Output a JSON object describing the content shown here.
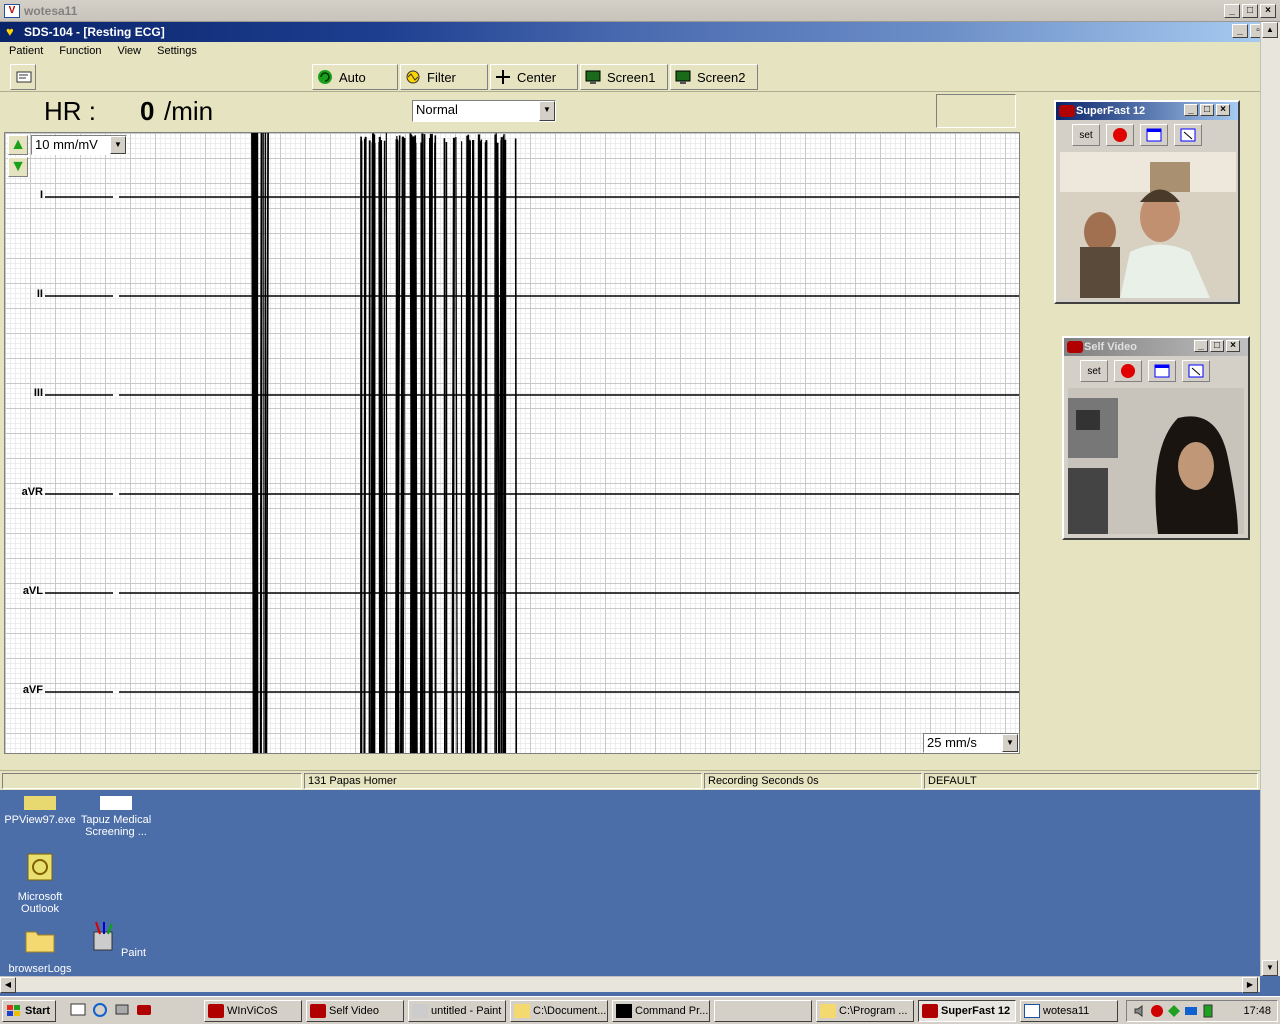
{
  "outer_window": {
    "title": "wotesa11",
    "icon_text": "V"
  },
  "app_window": {
    "title": "SDS-104 - [Resting ECG]"
  },
  "menu": [
    "Patient",
    "Function",
    "View",
    "Settings"
  ],
  "toolbar": {
    "buttons": [
      {
        "label": "Auto",
        "icon": "auto-icon"
      },
      {
        "label": "Filter",
        "icon": "filter-icon"
      },
      {
        "label": "Center",
        "icon": "center-icon"
      },
      {
        "label": "Screen1",
        "icon": "monitor-icon"
      },
      {
        "label": "Screen2",
        "icon": "monitor-icon"
      }
    ]
  },
  "ecg": {
    "hr_label": "HR :",
    "hr_value": "0",
    "hr_unit": "/min",
    "mode_select": "Normal",
    "gain_select": "10 mm/mV",
    "speed_select": "25 mm/s",
    "leads": [
      "I",
      "II",
      "III",
      "aVR",
      "aVL",
      "aVF"
    ]
  },
  "status_bar": {
    "patient": "131  Papas Homer",
    "recording": "Recording Seconds 0s",
    "profile": "DEFAULT"
  },
  "video_windows": [
    {
      "title": "SuperFast 12",
      "set_label": "set",
      "active": true
    },
    {
      "title": "Self Video",
      "set_label": "set",
      "active": false
    }
  ],
  "desktop_icons": [
    {
      "label": "PPView97.exe"
    },
    {
      "label": "Tapuz Medical Screening ..."
    },
    {
      "label": "Microsoft Outlook"
    },
    {
      "label": "browserLogs"
    },
    {
      "label": "Paint"
    }
  ],
  "taskbar": {
    "start": "Start",
    "items": [
      {
        "label": "WInViCoS",
        "active": false
      },
      {
        "label": "Self Video",
        "active": false
      },
      {
        "label": "untitled - Paint",
        "active": false
      },
      {
        "label": "C:\\Document...",
        "active": false
      },
      {
        "label": "Command Pr...",
        "active": false
      },
      {
        "label": "",
        "active": false
      },
      {
        "label": "C:\\Program ...",
        "active": false
      },
      {
        "label": "SuperFast 12",
        "active": true
      },
      {
        "label": "wotesa11",
        "active": false
      }
    ],
    "clock": "17:48"
  },
  "colors": {
    "app_bg": "#e5e3c0",
    "desktop_bg": "#4b6ea8",
    "title_active": "#0a246a",
    "trace": "#000000",
    "grid": "#c8c8c8"
  }
}
